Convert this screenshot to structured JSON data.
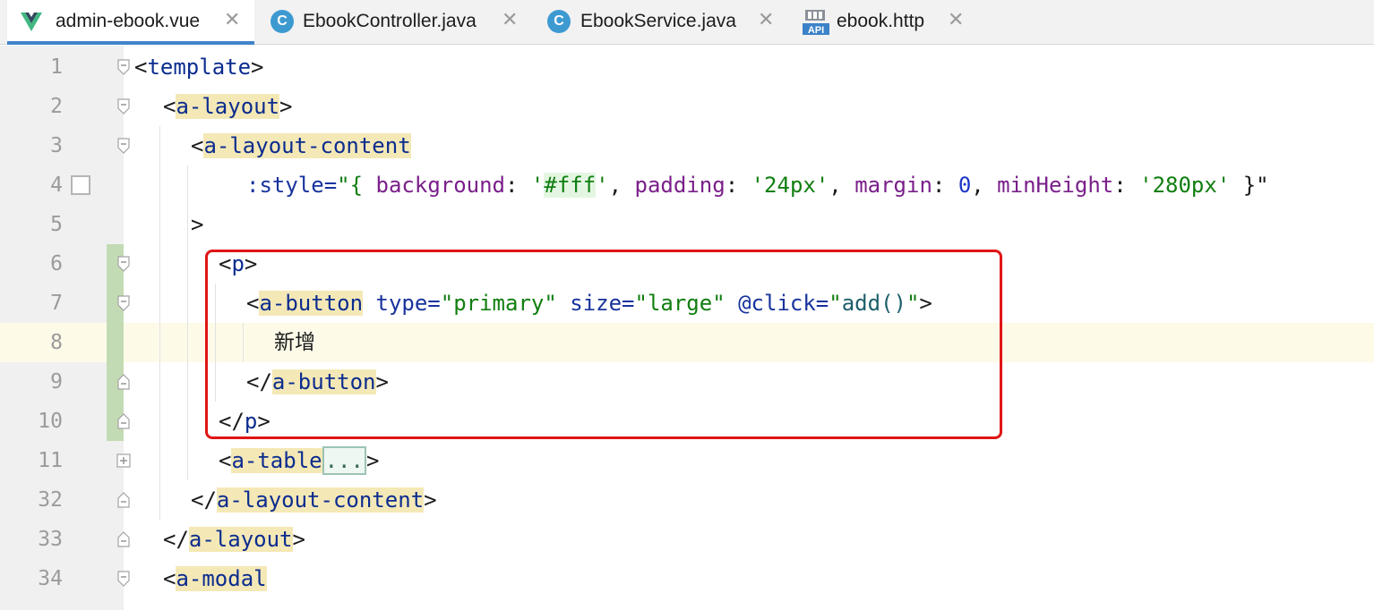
{
  "tabs": [
    {
      "label": "admin-ebook.vue",
      "icon": "vue-icon",
      "active": true
    },
    {
      "label": "EbookController.java",
      "icon": "class-icon",
      "active": false
    },
    {
      "label": "EbookService.java",
      "icon": "class-icon",
      "active": false
    },
    {
      "label": "ebook.http",
      "icon": "api-icon",
      "active": false
    }
  ],
  "icons": {
    "class_letter": "C",
    "api_text": "API",
    "close": "✕"
  },
  "line_numbers": [
    "1",
    "2",
    "3",
    "4",
    "5",
    "6",
    "7",
    "8",
    "9",
    "10",
    "11",
    "32",
    "33",
    "34"
  ],
  "code": {
    "l1_open": "<",
    "l1_tag": "template",
    "l1_close": ">",
    "l2_open": "<",
    "l2_tag": "a-layout",
    "l2_close": ">",
    "l3_open": "<",
    "l3_tag": "a-layout-content",
    "l4_attr": ":style=",
    "l4_q1": "\"{ ",
    "l4_bg": "background",
    "l4_colon1": ": ",
    "l4_bgval_a": "'",
    "l4_bgval_b": "#fff",
    "l4_bgval_c": "'",
    "l4_comma1": ", ",
    "l4_pad": "padding",
    "l4_colon2": ": ",
    "l4_padval": "'24px'",
    "l4_comma2": ", ",
    "l4_margin": "margin",
    "l4_colon3": ": ",
    "l4_marginval": "0",
    "l4_comma3": ", ",
    "l4_minh": "minHeight",
    "l4_colon4": ": ",
    "l4_minhval": "'280px'",
    "l4_q2": " }\"",
    "l5_text": ">",
    "l6_open": "<",
    "l6_tag": "p",
    "l6_close": ">",
    "l7_open": "<",
    "l7_tag": "a-button",
    "l7_type_attr": "type=",
    "l7_type_val": "\"primary\"",
    "l7_size_attr": "size=",
    "l7_size_val": "\"large\"",
    "l7_click_attr": "@click=",
    "l7_click_q1": "\"",
    "l7_click_val": "add()",
    "l7_click_q2": "\"",
    "l7_close": ">",
    "l8_text": "新增",
    "l9_open": "</",
    "l9_tag": "a-button",
    "l9_close": ">",
    "l10_open": "</",
    "l10_tag": "p",
    "l10_close": ">",
    "l11_open": "<",
    "l11_tag": "a-table",
    "l11_ellipsis": "...",
    "l11_close": ">",
    "l32_open": "</",
    "l32_tag": "a-layout-content",
    "l32_close": ">",
    "l33_open": "</",
    "l33_tag": "a-layout",
    "l33_close": ">",
    "l34_open": "<",
    "l34_tag": "a-modal"
  },
  "colors": {
    "accent": "#4083c9",
    "highlight_box": "#e01515",
    "tag": "#0b2c8f",
    "string": "#107e10"
  }
}
